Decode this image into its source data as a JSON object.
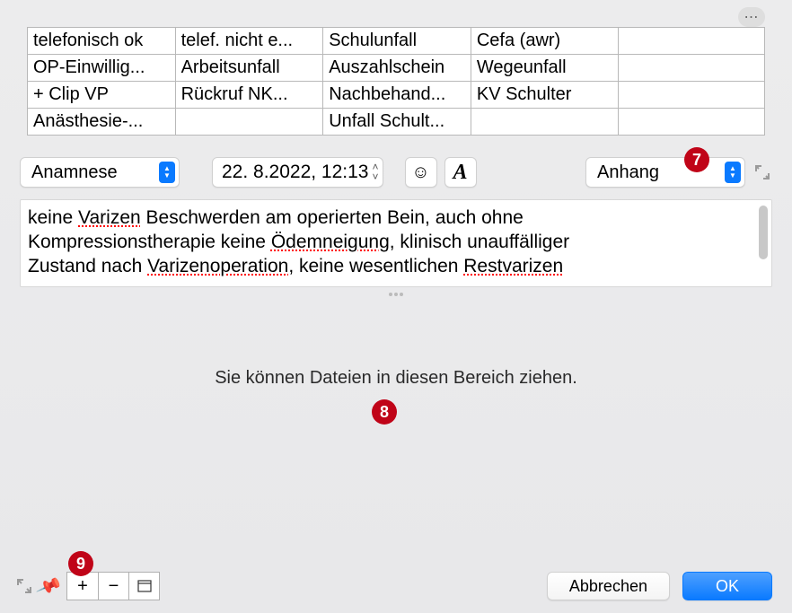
{
  "more_label": "⋯",
  "grid": {
    "rows": [
      [
        "telefonisch ok",
        "telef. nicht e...",
        "Schulunfall",
        "Cefa (awr)",
        ""
      ],
      [
        "OP-Einwillig...",
        "Arbeitsunfall",
        "Auszahlschein",
        "Wegeunfall",
        ""
      ],
      [
        "+ Clip VP",
        "Rückruf NK...",
        "Nachbehand...",
        "KV Schulter",
        ""
      ],
      [
        "Anästhesie-...",
        "",
        "Unfall Schult...",
        "",
        ""
      ]
    ]
  },
  "toolbar": {
    "category": "Anamnese",
    "datetime": "22.  8.2022, 12:13",
    "attachment": "Anhang"
  },
  "textarea": {
    "t1a": "keine ",
    "t1b": "Varizen",
    "t1c": " Beschwerden am operierten Bein, auch ohne",
    "t2a": "Kompressionstherapie keine ",
    "t2b": "Ödemneigung",
    "t2c": ", klinisch unauffälliger",
    "t3a": "Zustand nach ",
    "t3b": "Varizenoperation",
    "t3c": ", keine wesentlichen ",
    "t3d": "Restvarizen"
  },
  "dropzone": {
    "hint": "Sie können Dateien in diesen Bereich ziehen."
  },
  "callouts": {
    "c7": "7",
    "c8": "8",
    "c9": "9"
  },
  "footer": {
    "plus": "+",
    "minus": "−",
    "window": "◰",
    "cancel": "Abbrechen",
    "ok": "OK"
  }
}
